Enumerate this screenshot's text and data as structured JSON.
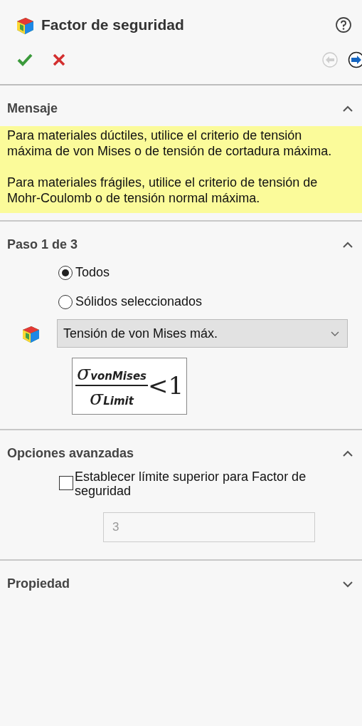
{
  "window": {
    "title": "Factor de seguridad"
  },
  "toolbar": {
    "back_disabled": true,
    "next_disabled": false
  },
  "sections": [
    {
      "kind": "message",
      "title": "Mensaje",
      "expanded": true,
      "paragraphs": [
        "Para materiales dúctiles, utilice el criterio de tensión máxima de von Mises o de tensión de cortadura máxima.",
        "Para materiales frágiles, utilice el criterio de tensión de Mohr-Coulomb o de tensión normal máxima."
      ]
    },
    {
      "kind": "step",
      "title": "Paso 1 de 3",
      "expanded": true,
      "radios": [
        {
          "label": "Todos",
          "selected": true
        },
        {
          "label": "Sólidos seleccionados",
          "selected": false
        }
      ],
      "dropdown": {
        "value": "Tensión de von Mises máx."
      },
      "formula": {
        "numerator": {
          "symbol": "σ",
          "subscript": "vonMises"
        },
        "denominator": {
          "symbol": "σ",
          "subscript": "Limit"
        },
        "relation": "<1"
      }
    },
    {
      "kind": "options",
      "title": "Opciones avanzadas",
      "expanded": true,
      "checkbox": {
        "label": "Establecer límite superior para Factor de seguridad",
        "checked": false
      },
      "field": {
        "value": "3",
        "disabled": true
      }
    },
    {
      "title": "Propiedad",
      "expanded": false
    }
  ]
}
